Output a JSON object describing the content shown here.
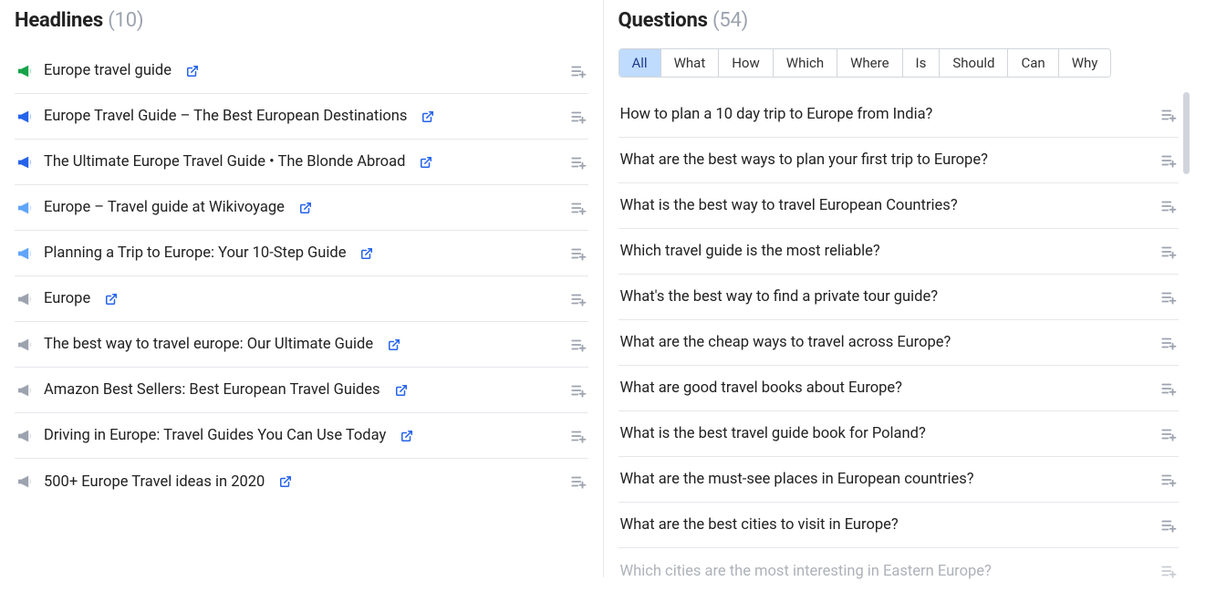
{
  "headlines": {
    "title": "Headlines",
    "count": "(10)",
    "items": [
      {
        "text": "Europe travel guide",
        "icon_color": "#16a34a",
        "muted": false
      },
      {
        "text": "Europe Travel Guide – The Best European Destinations",
        "icon_color": "#2563eb",
        "muted": false
      },
      {
        "text": "The Ultimate Europe Travel Guide • The Blonde Abroad",
        "icon_color": "#2563eb",
        "muted": false
      },
      {
        "text": "Europe – Travel guide at Wikivoyage",
        "icon_color": "#60a5fa",
        "muted": true
      },
      {
        "text": "Planning a Trip to Europe: Your 10-Step Guide",
        "icon_color": "#60a5fa",
        "muted": true
      },
      {
        "text": "Europe",
        "icon_color": "#9ca3af",
        "muted": true
      },
      {
        "text": "The best way to travel europe: Our Ultimate Guide",
        "icon_color": "#9ca3af",
        "muted": true
      },
      {
        "text": "Amazon Best Sellers: Best European Travel Guides",
        "icon_color": "#9ca3af",
        "muted": true
      },
      {
        "text": "Driving in Europe: Travel Guides You Can Use Today",
        "icon_color": "#9ca3af",
        "muted": true
      },
      {
        "text": "500+ Europe Travel ideas in 2020",
        "icon_color": "#9ca3af",
        "muted": true
      }
    ]
  },
  "questions": {
    "title": "Questions",
    "count": "(54)",
    "tabs": [
      "All",
      "What",
      "How",
      "Which",
      "Where",
      "Is",
      "Should",
      "Can",
      "Why"
    ],
    "active_tab": "All",
    "items": [
      {
        "text": "How to plan a 10 day trip to Europe from India?"
      },
      {
        "text": "What are the best ways to plan your first trip to Europe?"
      },
      {
        "text": "What is the best way to travel European Countries?"
      },
      {
        "text": "Which travel guide is the most reliable?"
      },
      {
        "text": "What's the best way to find a private tour guide?"
      },
      {
        "text": "What are the cheap ways to travel across Europe?"
      },
      {
        "text": "What are good travel books about Europe?"
      },
      {
        "text": "What is the best travel guide book for Poland?"
      },
      {
        "text": "What are the must-see places in European countries?"
      },
      {
        "text": "What are the best cities to visit in Europe?"
      },
      {
        "text": "Which cities are the most interesting in Eastern Europe?",
        "faded": true
      }
    ]
  }
}
